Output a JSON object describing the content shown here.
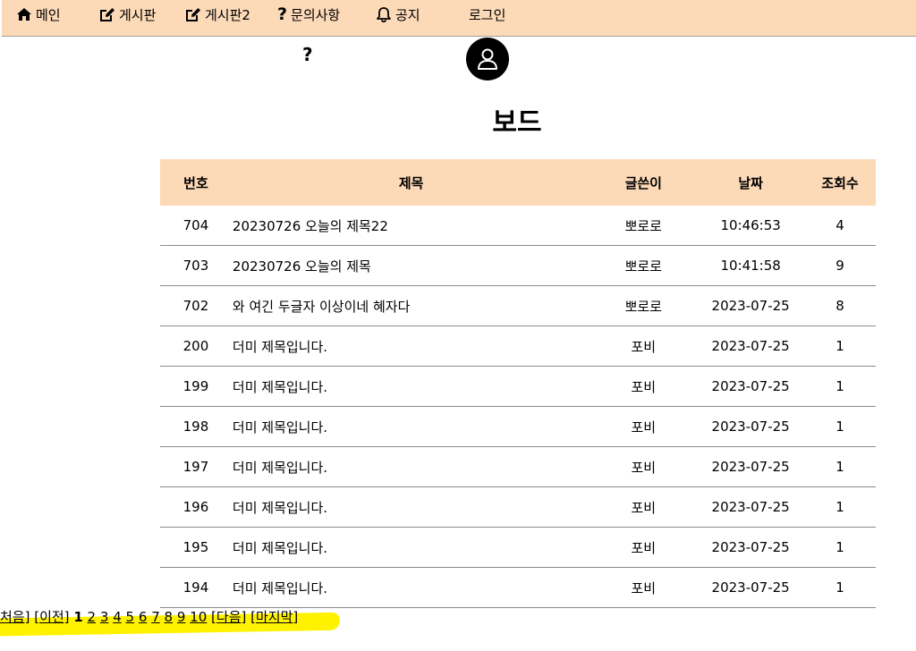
{
  "nav": {
    "items": [
      {
        "label": "메인",
        "icon": "home-icon"
      },
      {
        "label": "게시판",
        "icon": "edit-icon"
      },
      {
        "label": "게시판2",
        "icon": "edit-icon"
      },
      {
        "label": "문의사항",
        "icon": "question-icon"
      },
      {
        "label": "공지",
        "icon": "bell-icon"
      },
      {
        "label": "로그인",
        "icon": ""
      }
    ]
  },
  "help_glyph": "?",
  "nav_question_glyph": "?",
  "page": {
    "title": "보드"
  },
  "table": {
    "headers": [
      "번호",
      "제목",
      "글쓴이",
      "날짜",
      "조회수"
    ],
    "rows": [
      [
        "704",
        "20230726 오늘의 제목22",
        "뽀로로",
        "10:46:53",
        "4"
      ],
      [
        "703",
        "20230726 오늘의 제목",
        "뽀로로",
        "10:41:58",
        "9"
      ],
      [
        "702",
        "와 여긴 두글자 이상이네 혜자다",
        "뽀로로",
        "2023-07-25",
        "8"
      ],
      [
        "200",
        "더미 제목입니다.",
        "포비",
        "2023-07-25",
        "1"
      ],
      [
        "199",
        "더미 제목입니다.",
        "포비",
        "2023-07-25",
        "1"
      ],
      [
        "198",
        "더미 제목입니다.",
        "포비",
        "2023-07-25",
        "1"
      ],
      [
        "197",
        "더미 제목입니다.",
        "포비",
        "2023-07-25",
        "1"
      ],
      [
        "196",
        "더미 제목입니다.",
        "포비",
        "2023-07-25",
        "1"
      ],
      [
        "195",
        "더미 제목입니다.",
        "포비",
        "2023-07-25",
        "1"
      ],
      [
        "194",
        "더미 제목입니다.",
        "포비",
        "2023-07-25",
        "1"
      ]
    ]
  },
  "pager": {
    "first": "처음]",
    "prev": "[이전]",
    "current": "1",
    "pages": [
      "2",
      "3",
      "4",
      "5",
      "6",
      "7",
      "8",
      "9",
      "10"
    ],
    "next": "[다음]",
    "last": "[마지막]"
  },
  "colors": {
    "nav_bg": "#fcd9b7",
    "header_bg": "#fcd9b7",
    "highlight": "#fff200"
  }
}
